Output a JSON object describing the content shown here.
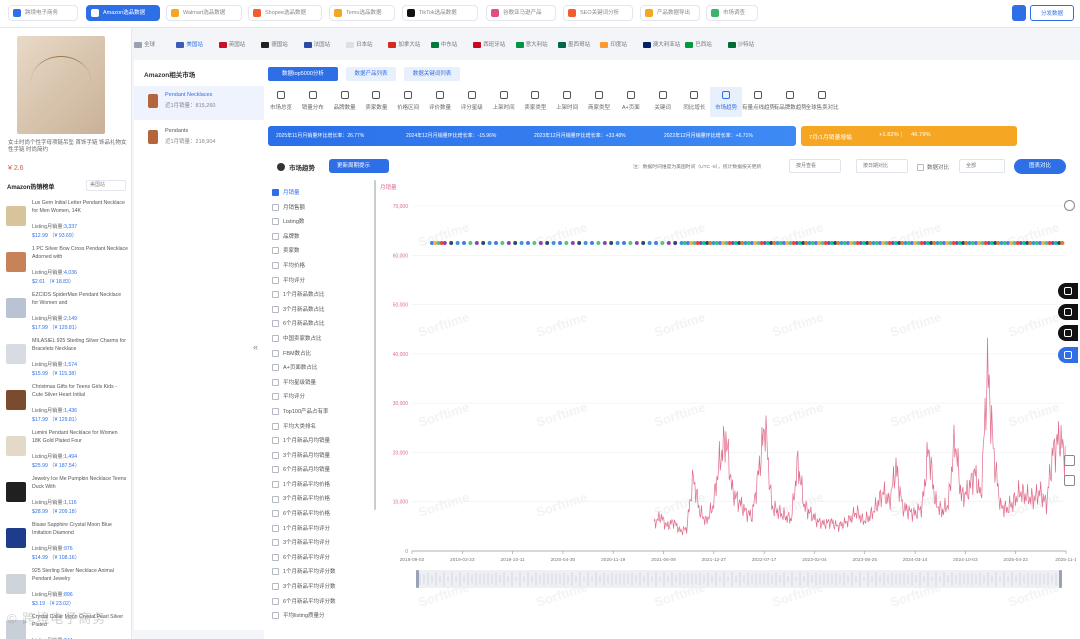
{
  "top_tabs": [
    {
      "label": "跨境电子商务",
      "active": false,
      "color": "#2f6fe6"
    },
    {
      "label": "Amazon选品数据",
      "active": true,
      "color": "#f5a623"
    },
    {
      "label": "Walmart选品数据",
      "active": false,
      "color": "#f5a623"
    },
    {
      "label": "Shopee选品数据",
      "active": false,
      "color": "#f25c2e"
    },
    {
      "label": "Temu选品数据",
      "active": false,
      "color": "#f5a623"
    },
    {
      "label": "TikTok选品数据",
      "active": false,
      "color": "#111111"
    },
    {
      "label": "谷歌亚马逊产品",
      "active": false,
      "color": "#e14b86"
    },
    {
      "label": "SEO关键词分析",
      "active": false,
      "color": "#f25c2e"
    },
    {
      "label": "产品数据导出",
      "active": false,
      "color": "#f5a623"
    },
    {
      "label": "市场调查",
      "active": false,
      "color": "#3db36b"
    }
  ],
  "top_right": {
    "icon_label": "",
    "button_label": "分发数据"
  },
  "left_panel": {
    "product_title": "女士时尚个性字母项链吊坠 首饰手链 饰品礼物女性手链 时尚简约",
    "price": "¥ 2.6",
    "rank_heading": "Amazon热销榜单",
    "rank_select": "美国站",
    "collapse_icon": "«",
    "items": [
      {
        "title": "Lux Gem Initial Letter Pendant Necklace for Men Women, 14K",
        "sales_label": "Listing月销量:",
        "sales": "3,337",
        "price": "$12.99 （¥ 93.69）",
        "thumb_color": "#d7c49c"
      },
      {
        "title": "1 PC Silver Bow Cross Pendant Necklace Adorned with",
        "sales_label": "Listing月销量:",
        "sales": "4,036",
        "price": "$2.61 （¥ 18.83）",
        "thumb_color": "#c8825a"
      },
      {
        "title": "EZCIDS SpiderMan Pendant Necklace for Women and",
        "sales_label": "Listing月销量:",
        "sales": "2,149",
        "price": "$17.99 （¥ 129.81）",
        "thumb_color": "#b9c3d3"
      },
      {
        "title": "MILASIEL 925 Sterling Silver Charms for Bracelets Necklace",
        "sales_label": "Listing月销量:",
        "sales": "1,574",
        "price": "$15.99 （¥ 115.38）",
        "thumb_color": "#d8dbe1"
      },
      {
        "title": "Christmas Gifts for Teens Girls Kids - Cute Silver Heart Initial",
        "sales_label": "Listing月销量:",
        "sales": "1,436",
        "price": "$17.99 （¥ 129.81）",
        "thumb_color": "#7a4c2d"
      },
      {
        "title": "Lumini Pendant Necklace for Women 18K Gold Plated Four",
        "sales_label": "Listing月销量:",
        "sales": "1,494",
        "price": "$25.99 （¥ 187.54）",
        "thumb_color": "#e2d9c9"
      },
      {
        "title": "Jewelry Ice Me Pumpkin Necklace Teens Duck With",
        "sales_label": "Listing月销量:",
        "sales": "1,116",
        "price": "$28.99 （¥ 209.18）",
        "thumb_color": "#202020"
      },
      {
        "title": "Bisaw Sapphire Crystal Moon Blue Imitation Diamond",
        "sales_label": "Listing月销量:",
        "sales": "976",
        "price": "$14.99 （¥ 108.16）",
        "thumb_color": "#1f3b8c"
      },
      {
        "title": "925 Sterling Silver Necklace Animal Pendant Jewelry",
        "sales_label": "Listing月销量:",
        "sales": "896",
        "price": "$3.19 （¥ 23.02）",
        "thumb_color": "#cfd3da"
      },
      {
        "title": "Crystal Collar Moon Crystal Pearl Silver Plated",
        "sales_label": "Listing月销量:",
        "sales": "844",
        "price": "",
        "thumb_color": "#c9cfd8"
      }
    ]
  },
  "countries": [
    {
      "label": "全球",
      "color": "#9aa2b1"
    },
    {
      "label": "美国站",
      "color": "#3b5bb5",
      "active": true
    },
    {
      "label": "英国站",
      "color": "#c8102e"
    },
    {
      "label": "德国站",
      "color": "#222222"
    },
    {
      "label": "法国站",
      "color": "#2a4aa8"
    },
    {
      "label": "日本站",
      "color": "#e0e0e0"
    },
    {
      "label": "加拿大站",
      "color": "#d52b1e"
    },
    {
      "label": "中东站",
      "color": "#007a3d"
    },
    {
      "label": "西班牙站",
      "color": "#c60b1e"
    },
    {
      "label": "意大利站",
      "color": "#009246"
    },
    {
      "label": "墨西哥站",
      "color": "#006847"
    },
    {
      "label": "印度站",
      "color": "#ff9933"
    },
    {
      "label": "澳大利亚站",
      "color": "#012169"
    },
    {
      "label": "巴西站",
      "color": "#009c3b"
    },
    {
      "label": "沙特站",
      "color": "#006c35"
    }
  ],
  "market": {
    "heading": "Amazon相关市场",
    "items": [
      {
        "name": "Pendant Necklaces",
        "value": "近1月销量：815,260",
        "active": true
      },
      {
        "name": "Pendants",
        "value": "近1月销量：218,904",
        "active": false
      }
    ]
  },
  "subtabs": [
    "数据top5000分析",
    "数据产品列表",
    "数据关键词列表"
  ],
  "metrics": [
    "市场总览",
    "销量分布",
    "品牌数量",
    "卖家数量",
    "价格区间",
    "评价数量",
    "评分星级",
    "上架时间",
    "卖家类型",
    "上架时间",
    "商家类型",
    "A+页面",
    "关键词",
    "同比增长",
    "市场趋势",
    "有量点线趋势",
    "有品牌数趋势",
    "全球售卖对比"
  ],
  "selected_metric_index": 14,
  "banner": {
    "items": [
      "2025年11月月销量环比增长率：26.77%",
      "2024年12月月销量环比增长率：-15.96%",
      "2023年12月月销量环比增长率：+33.48%",
      "2022年12月月销量环比增长率：+6.71%"
    ],
    "orange_label": "7月/1月销量增幅",
    "orange_a": "+1.82%",
    "orange_b": "46.79%"
  },
  "controls": {
    "title": "市场趋势",
    "dropdown": "更新周期提示",
    "note": "注：数据时间维度为美国时间（UTC -8），统计数据按天更新",
    "select1": "按月查看",
    "select2": "按日期对比",
    "checkbox_label": "数据对比",
    "select3": "全部",
    "button": "图表对比"
  },
  "checkboxes": [
    {
      "label": "月销量",
      "on": true
    },
    {
      "label": "月销售额",
      "on": false
    },
    {
      "label": "Listing数",
      "on": false
    },
    {
      "label": "品牌数",
      "on": false
    },
    {
      "label": "卖家数",
      "on": false
    },
    {
      "label": "平均价格",
      "on": false
    },
    {
      "label": "平均评分",
      "on": false
    },
    {
      "label": "1个月新品数占比",
      "on": false
    },
    {
      "label": "3个月新品数占比",
      "on": false
    },
    {
      "label": "6个月新品数占比",
      "on": false
    },
    {
      "label": "中国卖家数占比",
      "on": false
    },
    {
      "label": "FBM数占比",
      "on": false
    },
    {
      "label": "A+页面数占比",
      "on": false
    },
    {
      "label": "平均星级销量",
      "on": false
    },
    {
      "label": "平均评分",
      "on": false
    },
    {
      "label": "Top100产品占有率",
      "on": false
    },
    {
      "label": "平均大类排名",
      "on": false
    },
    {
      "label": "1个月新品月均销量",
      "on": false
    },
    {
      "label": "3个月新品月均销量",
      "on": false
    },
    {
      "label": "6个月新品月均销量",
      "on": false
    },
    {
      "label": "1个月新品平均价格",
      "on": false
    },
    {
      "label": "3个月新品平均价格",
      "on": false
    },
    {
      "label": "6个月新品平均价格",
      "on": false
    },
    {
      "label": "1个月新品平均评分",
      "on": false
    },
    {
      "label": "3个月新品平均评分",
      "on": false
    },
    {
      "label": "6个月新品平均评分",
      "on": false
    },
    {
      "label": "1个月新品平均评分数",
      "on": false
    },
    {
      "label": "3个月新品平均评分数",
      "on": false
    },
    {
      "label": "6个月新品平均评分数",
      "on": false
    },
    {
      "label": "平均listing质量分",
      "on": false
    }
  ],
  "watermark": "Sorftime",
  "bottom_watermark": "© 跨境电子商务",
  "chart_data": {
    "type": "line",
    "ylabel": "月销量",
    "ylim": [
      0,
      70000
    ],
    "yticks": [
      "0",
      "10,000",
      "20,000",
      "30,000",
      "40,000",
      "50,000",
      "60,000",
      "70,000"
    ],
    "x_tick_labels": [
      "2018-09-02",
      "2019-03-23",
      "2019-10-11",
      "2020-04-30",
      "2020-11-19",
      "2021-06-09",
      "2021-12-27",
      "2022-07-17",
      "2023-02-04",
      "2023-08-25",
      "2024-03-14",
      "2024-10-03",
      "2025-04-22",
      "2025-11-1"
    ],
    "series_color": "#e06b8a",
    "dot_colors": [
      "#4a7be8",
      "#f5b041",
      "#52c48a",
      "#e74c3c",
      "#8e44ad",
      "#1abc9c",
      "#34495e",
      "#e67e22",
      "#3498db",
      "#2ecc71"
    ],
    "series": [
      {
        "name": "月销量",
        "points": [
          [
            0.0,
            null
          ],
          [
            0.36,
            null
          ],
          [
            0.37,
            5500
          ],
          [
            0.38,
            7000
          ],
          [
            0.39,
            5000
          ],
          [
            0.4,
            6000
          ],
          [
            0.41,
            4000
          ],
          [
            0.42,
            4500
          ],
          [
            0.43,
            15000
          ],
          [
            0.44,
            8000
          ],
          [
            0.45,
            6000
          ],
          [
            0.46,
            9000
          ],
          [
            0.47,
            18000
          ],
          [
            0.48,
            23000
          ],
          [
            0.49,
            12000
          ],
          [
            0.5,
            10000
          ],
          [
            0.51,
            8000
          ],
          [
            0.52,
            7000
          ],
          [
            0.53,
            16000
          ],
          [
            0.54,
            26000
          ],
          [
            0.55,
            9000
          ],
          [
            0.56,
            8000
          ],
          [
            0.57,
            7000
          ],
          [
            0.58,
            6500
          ],
          [
            0.59,
            18000
          ],
          [
            0.6,
            9000
          ],
          [
            0.61,
            7500
          ],
          [
            0.62,
            6000
          ],
          [
            0.63,
            5500
          ],
          [
            0.64,
            6000
          ],
          [
            0.65,
            5000
          ],
          [
            0.66,
            5500
          ],
          [
            0.67,
            6500
          ],
          [
            0.68,
            8000
          ],
          [
            0.69,
            6000
          ],
          [
            0.7,
            7000
          ],
          [
            0.71,
            9000
          ],
          [
            0.72,
            12000
          ],
          [
            0.73,
            10000
          ],
          [
            0.74,
            17000
          ],
          [
            0.75,
            9000
          ],
          [
            0.76,
            8000
          ],
          [
            0.77,
            7500
          ],
          [
            0.78,
            9000
          ],
          [
            0.79,
            21000
          ],
          [
            0.8,
            10000
          ],
          [
            0.81,
            8000
          ],
          [
            0.82,
            9500
          ],
          [
            0.83,
            23000
          ],
          [
            0.84,
            11000
          ],
          [
            0.85,
            12000
          ],
          [
            0.86,
            16000
          ],
          [
            0.87,
            11000
          ],
          [
            0.88,
            37000
          ],
          [
            0.89,
            19000
          ],
          [
            0.9,
            9000
          ],
          [
            0.91,
            8500
          ],
          [
            0.92,
            10000
          ],
          [
            0.93,
            12000
          ],
          [
            0.94,
            11000
          ],
          [
            0.95,
            10500
          ],
          [
            0.96,
            12000
          ],
          [
            0.97,
            9500
          ],
          [
            0.98,
            20000
          ],
          [
            0.99,
            23000
          ],
          [
            1.0,
            19000
          ]
        ]
      }
    ]
  }
}
